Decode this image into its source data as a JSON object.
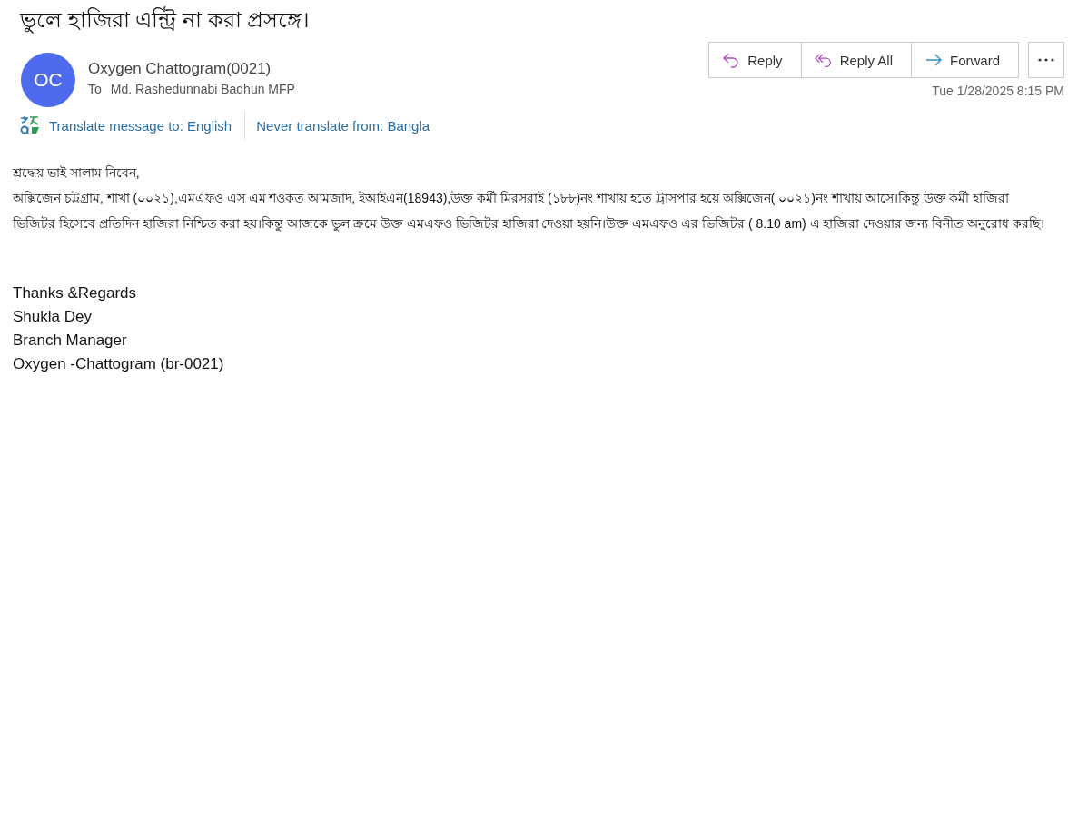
{
  "subject": "ভুলে হাজিরা এন্ট্রি না করা প্রসঙ্গে।",
  "sender": {
    "initials": "OC",
    "name": "Oxygen Chattogram(0021)",
    "to_label": "To",
    "to": "Md. Rashedunnabi Badhun MFP"
  },
  "actions": [
    {
      "kind": "reply",
      "label": "Reply"
    },
    {
      "kind": "reply_all",
      "label": "Reply All"
    },
    {
      "kind": "forward",
      "label": "Forward"
    }
  ],
  "date": "Tue 1/28/2025 8:15 PM",
  "translate": {
    "translate_link": "Translate message to: English",
    "never_link": "Never translate from: Bangla"
  },
  "body": {
    "greeting": "শ্রদ্ধেয় ভাই সালাম নিবেন,",
    "paragraph": "অক্সিজেন চট্টগ্রাম, শাখা (০০২১),এমএফও এস এম  শওকত আমজাদ, ইআইএন(18943),উক্ত কর্মী মিরসরাই (১৮৮)নং শাখায় হতে ট্রাসপার হয়ে অক্সিজেন( ০০২১)নং শাখায় আসে।কিন্তু উক্ত কর্মী হাজিরা ভিজিটর হিসেবে প্রতিদিন হাজিরা নিশ্চিত করা হয়।কিন্তু আজকে ভুল ক্রমে উক্ত এমএফও ভিজিটর হাজিরা দেওয়া হয়নি।উক্ত এমএফও এর ভিজিটর ( 8.10 am) এ হাজিরা দেওয়ার জন্য বিনীত অনুরোধ করছি।",
    "signature": [
      "Thanks &Regards",
      "Shukla Dey",
      "Branch Manager",
      "Oxygen -Chattogram (br-0021)"
    ]
  }
}
